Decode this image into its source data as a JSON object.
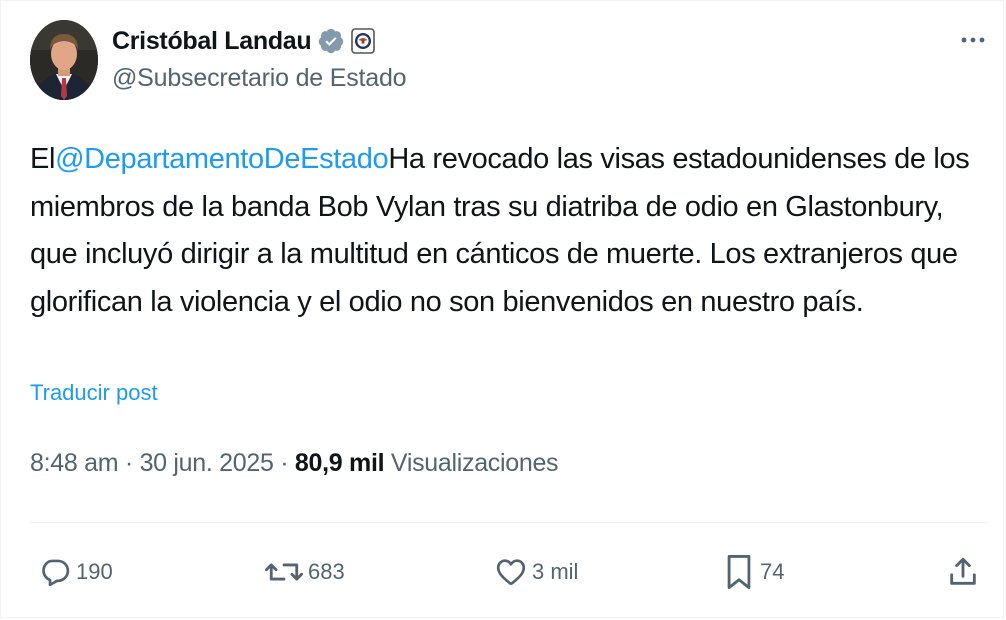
{
  "author": {
    "name": "Cristóbal Landau",
    "handle": "@Subsecretario de Estado"
  },
  "post": {
    "mention": "@DepartamentoDeEstado",
    "text_prefix": "El",
    "text_body": "Ha revocado las visas estadounidenses de los miembros de la banda Bob Vylan tras su diatriba de odio en Glastonbury, que incluyó dirigir a la multitud en cánticos de muerte. Los extranjeros que glorifican la violencia y el odio no son bienvenidos en nuestro país.",
    "translate_label": "Traducir post"
  },
  "meta": {
    "time": "8:48 am",
    "separator1": " · ",
    "date": "30 jun. 2025",
    "separator2": " · ",
    "views_count": "80,9 mil",
    "views_label": " Visualizaciones"
  },
  "actions": {
    "replies": "190",
    "reposts": "683",
    "likes": "3 mil",
    "bookmarks": "74"
  },
  "icons": {
    "verified": "verified-badge-icon",
    "affiliate": "state-department-seal-icon",
    "more": "more-options-icon",
    "reply": "reply-icon",
    "repost": "repost-icon",
    "like": "heart-icon",
    "bookmark": "bookmark-icon",
    "share": "share-icon"
  },
  "colors": {
    "link": "#1d9bf0",
    "secondary_text": "#536471",
    "primary_text": "#0f1419",
    "verified_badge": "#829aab"
  }
}
